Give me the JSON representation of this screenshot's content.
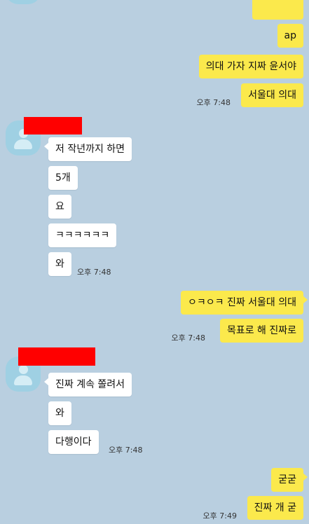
{
  "colors": {
    "background": "#b9cfe0",
    "my_bubble": "#fbe94c",
    "their_bubble": "#ffffff",
    "redaction": "#ff0000"
  },
  "messages_mine_1": [
    "ap",
    "의대 가자 지짜 윤서야",
    "서울대 의대"
  ],
  "time_mine_1": "오후 7:48",
  "messages_theirs_1": [
    "저 작년까지 하면",
    "5개",
    "요",
    "ㅋㅋㅋㅋㅋㅋ",
    "와"
  ],
  "time_theirs_1": "오후 7:48",
  "messages_mine_2": [
    "ㅇㅋㅇㅋ 진짜 서울대 의대",
    "목표로 해 진짜로"
  ],
  "time_mine_2": "오후 7:48",
  "messages_theirs_2": [
    "진짜 계속 쫄려서",
    "와",
    "다행이다"
  ],
  "time_theirs_2": "오후 7:48",
  "messages_mine_3": [
    "굳굳",
    "진짜 개 굳"
  ],
  "time_mine_3": "오후 7:49"
}
